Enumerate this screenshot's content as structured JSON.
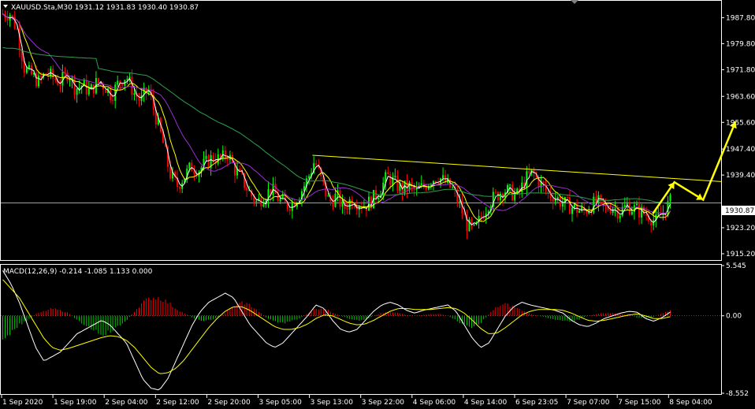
{
  "window": {
    "symbol_header": "XAUUSD.Sta,M30  1931.12 1931.83 1930.40 1930.87",
    "macd_header": "MACD(12,26,9) -0.214 -1.085 1.133 0.000"
  },
  "current_price_label": "1930.87",
  "chart_data": [
    {
      "type": "candlestick",
      "title": "",
      "price_ticks": [
        "1987.80",
        "1979.80",
        "1971.80",
        "1963.60",
        "1955.60",
        "1947.40",
        "1939.40",
        "1923.20",
        "1915.20"
      ],
      "current_price": 1930.87,
      "ylim": [
        1913.5,
        1992.5
      ],
      "time_ticks": [
        "1 Sep 2020",
        "1 Sep 19:00",
        "2 Sep 04:00",
        "2 Sep 12:00",
        "2 Sep 20:00",
        "3 Sep 05:00",
        "3 Sep 13:00",
        "3 Sep 22:00",
        "4 Sep 06:00",
        "4 Sep 14:00",
        "6 Sep 23:05",
        "7 Sep 07:00",
        "7 Sep 15:00",
        "8 Sep 04:00"
      ],
      "close_path": [
        1989,
        1989,
        1984,
        1972,
        1970,
        1968,
        1971,
        1969,
        1968,
        1971,
        1966,
        1967,
        1965,
        1968,
        1967,
        1964,
        1968,
        1970,
        1965,
        1962,
        1966,
        1958,
        1950,
        1940,
        1936,
        1939,
        1942,
        1941,
        1943,
        1945,
        1944,
        1946,
        1941,
        1938,
        1934,
        1931,
        1933,
        1935,
        1932,
        1930,
        1931,
        1934,
        1938,
        1944,
        1937,
        1931,
        1933,
        1929,
        1932,
        1931,
        1930,
        1932,
        1935,
        1939,
        1937,
        1935,
        1936,
        1934,
        1936,
        1938,
        1939,
        1937,
        1935,
        1930,
        1924,
        1922,
        1927,
        1931,
        1933,
        1935,
        1934,
        1933,
        1938,
        1940,
        1937,
        1934,
        1933,
        1931,
        1930,
        1929,
        1928,
        1930,
        1931,
        1929,
        1930,
        1928,
        1930,
        1929,
        1928,
        1927,
        1925,
        1928,
        1931
      ],
      "trendline": [
        {
          "x": 0.432,
          "y": 1945.5
        },
        {
          "x": 1.0,
          "y": 1937.4
        }
      ],
      "forecast_arrow": [
        {
          "x": 0.905,
          "y": 1927.5
        },
        {
          "x": 0.935,
          "y": 1937.2
        },
        {
          "x": 0.975,
          "y": 1931.8
        },
        {
          "x": 1.02,
          "y": 1955.8
        }
      ],
      "colors": {
        "bull": "#00ff00",
        "bear": "#ff0000",
        "ma_fast": "#ffffff",
        "ma_mid": "#ffff00",
        "ma_slow": "#9b2fd0",
        "ma_long": "#2ea04a",
        "trend": "#ffff00",
        "arrow": "#ffff00",
        "grid": "#ffffff"
      }
    },
    {
      "type": "macd",
      "title": "",
      "ticks": [
        "5.545",
        "0.00",
        "-8.552"
      ],
      "ylim": [
        -8.552,
        5.545
      ],
      "macd_path": [
        5,
        3.5,
        1.5,
        -1,
        -3.5,
        -5,
        -4.5,
        -4,
        -3,
        -2,
        -1.5,
        -1,
        -0.5,
        -1,
        -2,
        -3,
        -5,
        -7,
        -8,
        -8.2,
        -7,
        -5,
        -3,
        -1,
        0.5,
        1.5,
        2,
        2.5,
        2,
        0.5,
        -1,
        -2,
        -3,
        -3.5,
        -3,
        -2,
        -1,
        0,
        1.2,
        0.8,
        -0.5,
        -1.5,
        -1.8,
        -1.5,
        -0.5,
        0.5,
        1.2,
        1.5,
        1.2,
        0.6,
        0.3,
        0.6,
        0.8,
        1,
        1.2,
        0.5,
        -1,
        -2.5,
        -3.5,
        -3,
        -1.5,
        0,
        1,
        1.5,
        1.2,
        1,
        0.8,
        0.6,
        0.3,
        -0.5,
        -1,
        -1.2,
        -0.8,
        -0.3,
        0,
        0.3,
        0.5,
        0.4,
        -0.3,
        -0.6,
        -0.2,
        0.4
      ],
      "signal_path": [
        4,
        3,
        2,
        0.5,
        -1,
        -2.5,
        -3.5,
        -3.8,
        -3.6,
        -3.3,
        -3,
        -2.7,
        -2.4,
        -2.2,
        -2.3,
        -2.7,
        -3.5,
        -4.6,
        -5.7,
        -6.4,
        -6.3,
        -5.8,
        -4.9,
        -3.7,
        -2.5,
        -1.3,
        -0.3,
        0.5,
        1,
        1,
        0.6,
        0,
        -0.6,
        -1.2,
        -1.5,
        -1.5,
        -1.3,
        -0.9,
        -0.3,
        0.1,
        0,
        -0.4,
        -0.8,
        -1,
        -0.9,
        -0.5,
        0,
        0.5,
        0.8,
        0.8,
        0.7,
        0.7,
        0.7,
        0.8,
        0.9,
        0.8,
        0.3,
        -0.5,
        -1.4,
        -2,
        -1.9,
        -1.3,
        -0.6,
        0.1,
        0.5,
        0.7,
        0.7,
        0.7,
        0.6,
        0.3,
        -0.1,
        -0.5,
        -0.6,
        -0.5,
        -0.3,
        -0.1,
        0.1,
        0.2,
        0,
        -0.3,
        -0.3,
        -0.1
      ],
      "hist_path": [
        -3,
        -2,
        -1,
        -0.5,
        0.2,
        0.5,
        0.8,
        0.6,
        0.3,
        -0.5,
        -1,
        -1.5,
        -2,
        -1.8,
        -1.2,
        -0.5,
        0.5,
        1.5,
        2,
        2,
        1.5,
        0.8,
        0.3,
        -0.2,
        -0.5,
        -0.5,
        -0.2,
        0.3,
        1,
        1.5,
        1.2,
        0.5,
        -0.2,
        -0.6,
        -0.8,
        -0.6,
        -0.3,
        0.3,
        0.8,
        0.8,
        0.4,
        0,
        -0.3,
        -0.5,
        -0.4,
        0,
        0.3,
        0.4,
        0.3,
        0.1,
        0,
        0.1,
        0.2,
        0.2,
        0,
        -0.5,
        -1,
        -1.2,
        -0.8,
        0.2,
        1,
        1.3,
        1,
        0.6,
        0.2,
        0,
        -0.2,
        -0.4,
        -0.5,
        -0.6,
        -0.4,
        0,
        0.2,
        0.3,
        0.3,
        0.2,
        0.1,
        -0.2,
        -0.3,
        -0.1,
        0.3,
        0.6
      ],
      "colors": {
        "macd": "#ffffff",
        "signal": "#ffff00",
        "hist_up": "#ff0000",
        "hist_down": "#00cc00",
        "grid": "#ffffff"
      }
    }
  ]
}
